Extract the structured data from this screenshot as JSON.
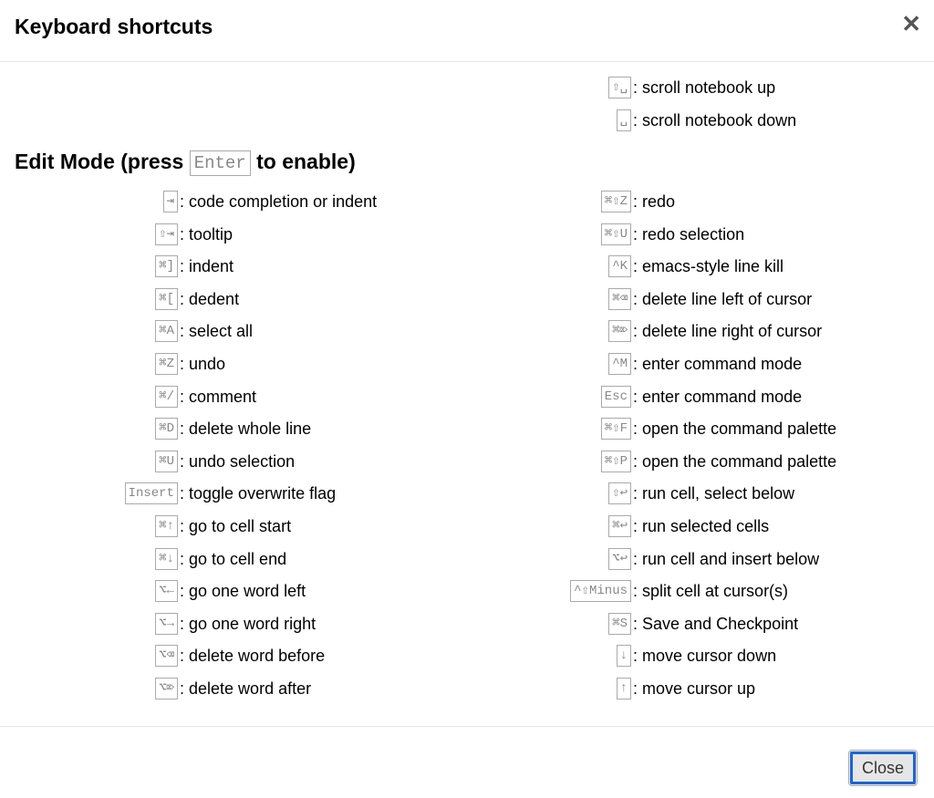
{
  "dialog": {
    "title": "Keyboard shortcuts",
    "close_icon": "close-icon",
    "close_glyph": "✕",
    "footer": {
      "close_label": "Close"
    }
  },
  "command_mode_tail": [
    {
      "keys": "⇧␣",
      "desc": "scroll notebook up"
    },
    {
      "keys": "␣",
      "desc": "scroll notebook down"
    }
  ],
  "edit_mode": {
    "title_before": "Edit Mode (press",
    "title_key": "Enter",
    "title_after": "to enable)",
    "left": [
      {
        "keys": "⇥",
        "desc": "code completion or indent"
      },
      {
        "keys": "⇧⇥",
        "desc": "tooltip"
      },
      {
        "keys": "⌘]",
        "desc": "indent"
      },
      {
        "keys": "⌘[",
        "desc": "dedent"
      },
      {
        "keys": "⌘A",
        "desc": "select all"
      },
      {
        "keys": "⌘Z",
        "desc": "undo"
      },
      {
        "keys": "⌘/",
        "desc": "comment"
      },
      {
        "keys": "⌘D",
        "desc": "delete whole line"
      },
      {
        "keys": "⌘U",
        "desc": "undo selection"
      },
      {
        "keys": "Insert",
        "desc": "toggle overwrite flag"
      },
      {
        "keys": "⌘↑",
        "desc": "go to cell start"
      },
      {
        "keys": "⌘↓",
        "desc": "go to cell end"
      },
      {
        "keys": "⌥←",
        "desc": "go one word left"
      },
      {
        "keys": "⌥→",
        "desc": "go one word right"
      },
      {
        "keys": "⌥⌫",
        "desc": "delete word before"
      },
      {
        "keys": "⌥⌦",
        "desc": "delete word after"
      }
    ],
    "right": [
      {
        "keys": "⌘⇧Z",
        "desc": "redo"
      },
      {
        "keys": "⌘⇧U",
        "desc": "redo selection"
      },
      {
        "keys": "^K",
        "desc": "emacs-style line kill"
      },
      {
        "keys": "⌘⌫",
        "desc": "delete line left of cursor"
      },
      {
        "keys": "⌘⌦",
        "desc": "delete line right of cursor"
      },
      {
        "keys": "^M",
        "desc": "enter command mode"
      },
      {
        "keys": "Esc",
        "desc": "enter command mode"
      },
      {
        "keys": "⌘⇧F",
        "desc": "open the command palette"
      },
      {
        "keys": "⌘⇧P",
        "desc": "open the command palette"
      },
      {
        "keys": "⇧↩",
        "desc": "run cell, select below"
      },
      {
        "keys": "⌘↩",
        "desc": "run selected cells"
      },
      {
        "keys": "⌥↩",
        "desc": "run cell and insert below"
      },
      {
        "keys": "^⇧Minus",
        "desc": "split cell at cursor(s)"
      },
      {
        "keys": "⌘S",
        "desc": "Save and Checkpoint"
      },
      {
        "keys": "↓",
        "desc": "move cursor down"
      },
      {
        "keys": "↑",
        "desc": "move cursor up"
      }
    ]
  },
  "separator": ": "
}
